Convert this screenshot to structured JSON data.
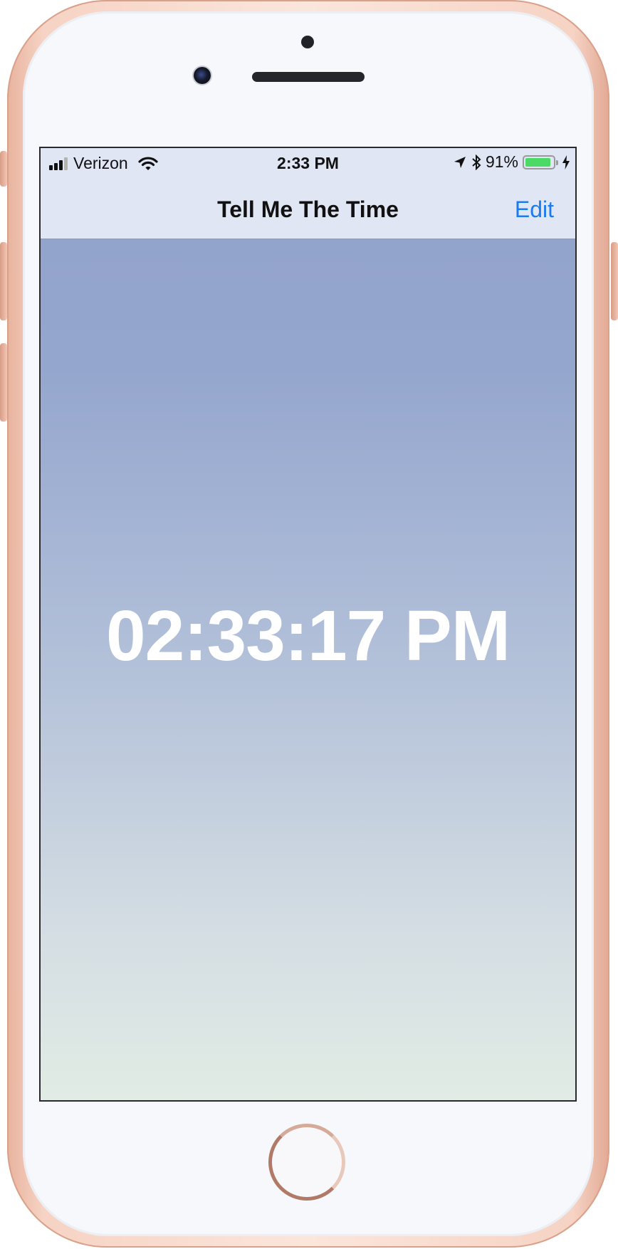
{
  "status_bar": {
    "carrier": "Verizon",
    "time": "2:33 PM",
    "battery_percent": "91%",
    "battery_level": 0.91,
    "icons": [
      "signal-icon",
      "wifi-icon",
      "location-icon",
      "bluetooth-icon",
      "battery-icon",
      "charging-icon"
    ]
  },
  "nav": {
    "title": "Tell Me The Time",
    "edit_label": "Edit"
  },
  "main": {
    "clock_text": "02:33:17 PM"
  },
  "colors": {
    "accent": "#1b7cf0",
    "nav_background": "#e1e6f5",
    "gradient_top": "#93a4cc",
    "gradient_bottom": "#e1ece5",
    "battery_fill": "#4cd964",
    "phone_frame": "#f3c6b4"
  }
}
